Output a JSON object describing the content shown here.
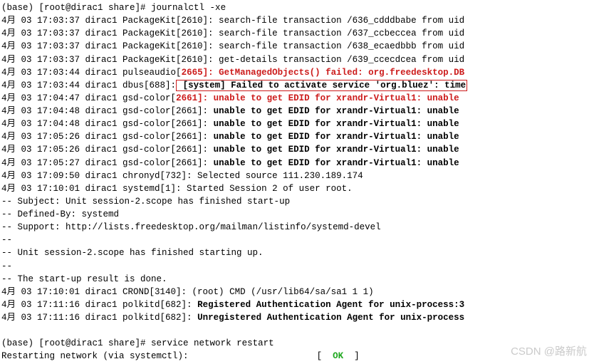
{
  "prompt1": "(base) [root@dirac1 share]# ",
  "cmd1": "journalctl -xe",
  "mon": "4月",
  "l1": " 03 17:03:37 dirac1 PackageKit[2610]: search-file transaction /636_cdddbabe from uid",
  "l2": " 03 17:03:37 dirac1 PackageKit[2610]: search-file transaction /637_ccbeccea from uid",
  "l3": " 03 17:03:37 dirac1 PackageKit[2610]: search-file transaction /638_ecaedbbb from uid",
  "l4": " 03 17:03:37 dirac1 PackageKit[2610]: get-details transaction /639_ccecdcea from uid",
  "l5a": " 03 17:03:44 dirac1 pulseaudio[",
  "l5b": "2665]: GetManagedObjects() failed: org.freedesktop.DB",
  "l6a": " 03 17:03:44 dirac1 dbus[688]:",
  "l6b": " [system] Failed to activate service 'org.bluez': time",
  "l7a": " 03 17:04:47 dirac1 gsd-color[",
  "l7b": "2661]: unable to get EDID for xrandr-Virtual1: unable",
  "l8a": " 03 17:04:48 dirac1 gsd-color[2661]: ",
  "l8b": "unable to get EDID for xrandr-Virtual1: unable",
  "l9a": " 03 17:04:48 dirac1 gsd-color[2661]: ",
  "l10a": " 03 17:05:26 dirac1 gsd-color[2661]: ",
  "l11a": " 03 17:05:26 dirac1 gsd-color[2661]: ",
  "l12a": " 03 17:05:27 dirac1 gsd-color[2661]: ",
  "l13": " 03 17:09:50 dirac1 chronyd[732]: Selected source 111.230.189.174",
  "l14": " 03 17:10:01 dirac1 systemd[1]: Started Session 2 of user root.",
  "s1": "-- Subject: Unit session-2.scope has finished start-up",
  "s2": "-- Defined-By: systemd",
  "s3": "-- Support: http://lists.freedesktop.org/mailman/listinfo/systemd-devel",
  "s4": "-- ",
  "s5": "-- Unit session-2.scope has finished starting up.",
  "s6": "-- The start-up result is done.",
  "l15": " 03 17:10:01 dirac1 CROND[3140]: (root) CMD (/usr/lib64/sa/sa1 1 1)",
  "l16a": " 03 17:11:16 dirac1 polkitd[682]: ",
  "l16b": "Registered Authentication Agent for unix-process:3",
  "l17a": " 03 17:11:16 dirac1 polkitd[682]: ",
  "l17b": "Unregistered Authentication Agent for unix-process",
  "blank": " ",
  "prompt2": "(base) [root@dirac1 share]# ",
  "cmd2": "service network restart",
  "rn": "Restarting network (via systemctl):                        [  ",
  "ok": "OK",
  "rn2": "  ]",
  "watermark": "CSDN @路新航"
}
